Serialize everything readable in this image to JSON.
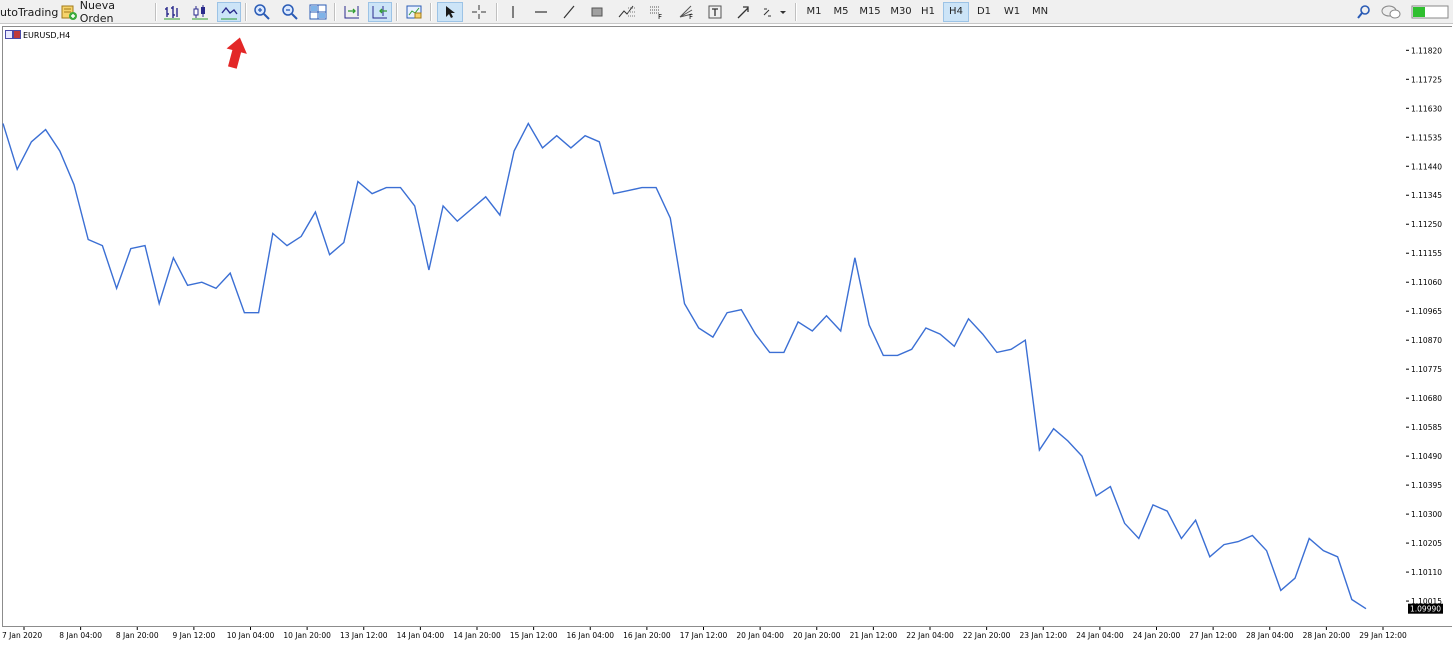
{
  "toolbar": {
    "autotrading_label": "utoTrading",
    "new_order_label": "Nueva Orden",
    "timeframes": [
      "M1",
      "M5",
      "M15",
      "M30",
      "H1",
      "H4",
      "D1",
      "W1",
      "MN"
    ],
    "active_timeframe": "H4",
    "icons": [
      "bar-chart-icon",
      "candlestick-icon",
      "line-chart-icon",
      "zoom-in-icon",
      "zoom-out-icon",
      "tile-windows-icon",
      "chart-shift-icon",
      "auto-scroll-icon",
      "templates-icon",
      "cursor-icon",
      "crosshair-icon",
      "vertical-line-icon",
      "horizontal-line-icon",
      "trend-line-icon",
      "rectangle-icon",
      "fibonacci-icon",
      "fibo-levels-icon",
      "fibo-fan-icon",
      "text-icon",
      "arrow-icon",
      "indicators-icon",
      "search-icon",
      "chat-icon",
      "connection-status-icon"
    ]
  },
  "chart": {
    "symbol_label": "EURUSD,H4",
    "current_price_label": "1.09990",
    "line_color": "#3b6fd4"
  },
  "chart_data": {
    "type": "line",
    "title": "EURUSD,H4",
    "ylim": [
      1.0993,
      1.1188
    ],
    "y_ticks": [
      "1.11820",
      "1.11725",
      "1.11630",
      "1.11535",
      "1.11440",
      "1.11345",
      "1.11250",
      "1.11155",
      "1.11060",
      "1.10965",
      "1.10870",
      "1.10775",
      "1.10680",
      "1.10585",
      "1.10490",
      "1.10395",
      "1.10300",
      "1.10205",
      "1.10110",
      "1.10015"
    ],
    "x_ticks": [
      "7 Jan 2020",
      "8 Jan 04:00",
      "8 Jan 20:00",
      "9 Jan 12:00",
      "10 Jan 04:00",
      "10 Jan 20:00",
      "13 Jan 12:00",
      "14 Jan 04:00",
      "14 Jan 20:00",
      "15 Jan 12:00",
      "16 Jan 04:00",
      "16 Jan 20:00",
      "17 Jan 12:00",
      "20 Jan 04:00",
      "20 Jan 20:00",
      "21 Jan 12:00",
      "22 Jan 04:00",
      "22 Jan 20:00",
      "23 Jan 12:00",
      "24 Jan 04:00",
      "24 Jan 20:00",
      "27 Jan 12:00",
      "28 Jan 04:00",
      "28 Jan 20:00",
      "29 Jan 12:00"
    ],
    "series": [
      {
        "values": [
          1.1158,
          1.1143,
          1.1152,
          1.1156,
          1.1149,
          1.1138,
          1.112,
          1.1118,
          1.1104,
          1.1117,
          1.1118,
          1.1099,
          1.1114,
          1.1105,
          1.1106,
          1.1104,
          1.1109,
          1.1096,
          1.1096,
          1.1122,
          1.1118,
          1.1121,
          1.1129,
          1.1115,
          1.1119,
          1.1139,
          1.1135,
          1.1137,
          1.1137,
          1.1131,
          1.111,
          1.1131,
          1.1126,
          1.113,
          1.1134,
          1.1128,
          1.1149,
          1.1158,
          1.115,
          1.1154,
          1.115,
          1.1154,
          1.1152,
          1.1135,
          1.1136,
          1.1137,
          1.1137,
          1.1127,
          1.1099,
          1.1091,
          1.1088,
          1.1096,
          1.1097,
          1.1089,
          1.1083,
          1.1083,
          1.1093,
          1.109,
          1.1095,
          1.109,
          1.1114,
          1.1092,
          1.1082,
          1.1082,
          1.1084,
          1.1091,
          1.1089,
          1.1085,
          1.1094,
          1.1089,
          1.1083,
          1.1084,
          1.1087,
          1.1051,
          1.1058,
          1.1054,
          1.1049,
          1.1036,
          1.1039,
          1.1027,
          1.1022,
          1.1033,
          1.1031,
          1.1022,
          1.1028,
          1.1016,
          1.102,
          1.1021,
          1.1023,
          1.1018,
          1.1005,
          1.1009,
          1.1022,
          1.1018,
          1.1016,
          1.1002,
          1.0999
        ]
      }
    ]
  }
}
